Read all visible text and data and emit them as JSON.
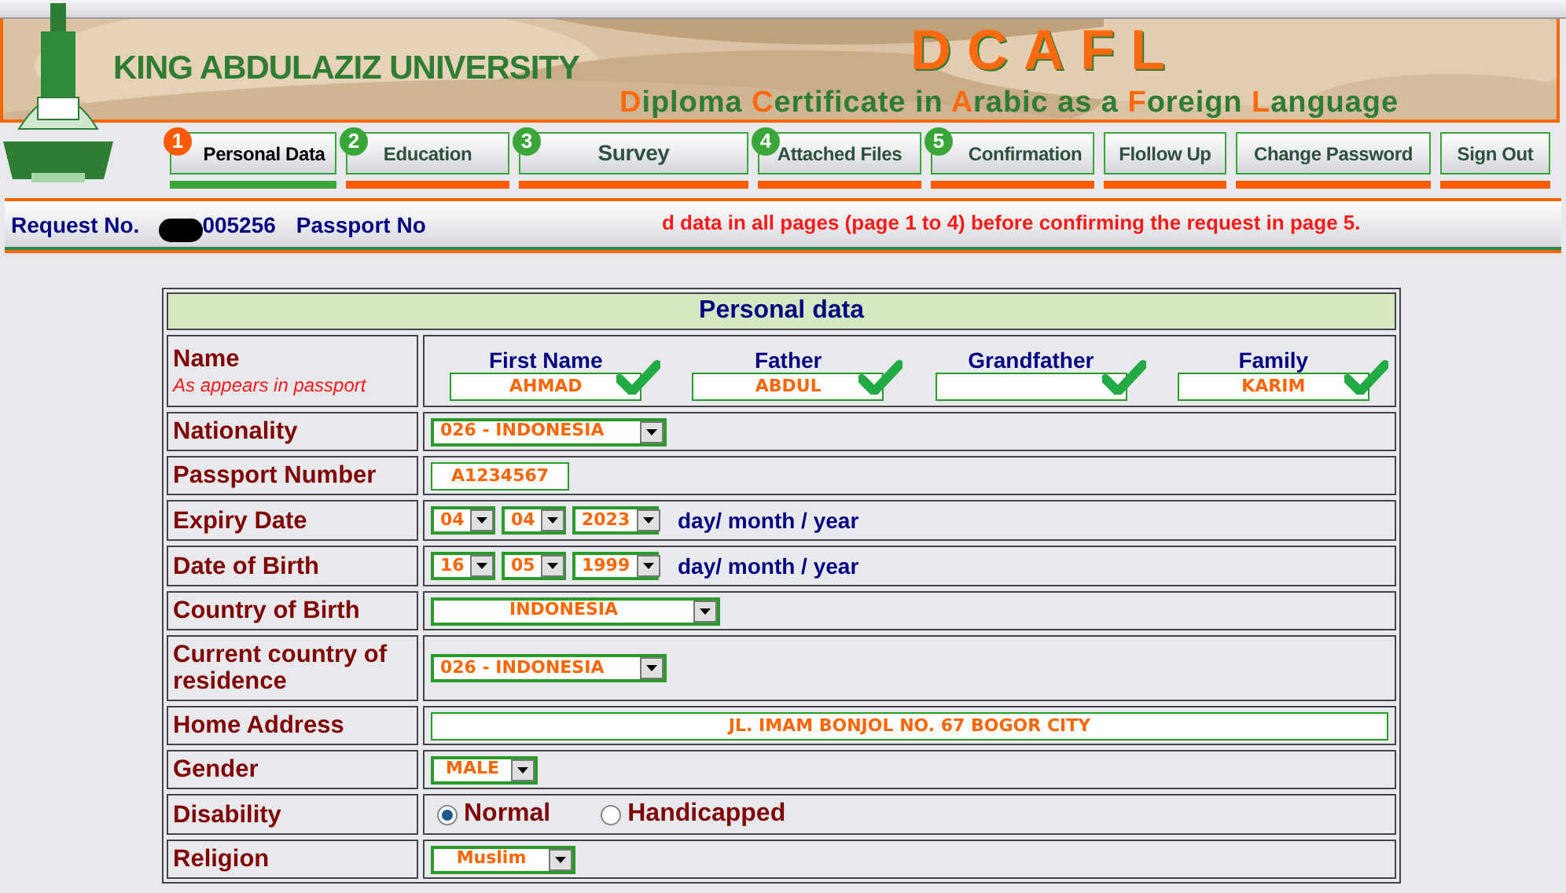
{
  "banner": {
    "university": "KING ABDULAZIZ UNIVERSITY",
    "acronym": "DCAFL",
    "subtitle_parts": [
      {
        "text": "D",
        "accent": true
      },
      {
        "text": "iploma ",
        "accent": false
      },
      {
        "text": "C",
        "accent": true
      },
      {
        "text": "ertificate in ",
        "accent": false
      },
      {
        "text": "A",
        "accent": true
      },
      {
        "text": "rabic as a ",
        "accent": false
      },
      {
        "text": "F",
        "accent": true
      },
      {
        "text": "oreign ",
        "accent": false
      },
      {
        "text": "L",
        "accent": true
      },
      {
        "text": "anguage",
        "accent": false
      }
    ]
  },
  "nav": [
    {
      "number": "1",
      "label": "Personal Data",
      "selected": true
    },
    {
      "number": "2",
      "label": "Education",
      "selected": false
    },
    {
      "number": "3",
      "label": "Survey",
      "selected": false
    },
    {
      "number": "4",
      "label": "Attached Files",
      "selected": false
    },
    {
      "number": "5",
      "label": "Confirmation",
      "selected": false
    },
    {
      "label": "Flollow Up",
      "selected": false
    },
    {
      "label": "Change Password",
      "selected": false
    },
    {
      "label": "Sign Out",
      "selected": false
    }
  ],
  "request_bar": {
    "request_label": "Request No.",
    "request_number": "005256",
    "passport_label": "Passport No",
    "notice": "d data in all pages (page 1 to 4) before confirming the request in page 5."
  },
  "form": {
    "title": "Personal data",
    "rows": [
      {
        "kind": "name",
        "label": "Name",
        "sublabel": "As appears in passport",
        "parts": [
          {
            "label": "First Name",
            "value": "AHMAD",
            "checked": true
          },
          {
            "label": "Father",
            "value": "ABDUL",
            "checked": true
          },
          {
            "label": "Grandfather",
            "checked": true
          },
          {
            "label": "Family",
            "value": "KARIM",
            "checked": true
          }
        ]
      },
      {
        "kind": "select",
        "label": "Nationality",
        "value": "026 - INDONESIA"
      },
      {
        "kind": "text",
        "label": "Passport Number",
        "value": "A1234567"
      },
      {
        "kind": "date",
        "label": "Expiry Date",
        "fields": [
          "04",
          "04",
          "2023"
        ],
        "hint": "day/ month / year"
      },
      {
        "kind": "date",
        "label": "Date of Birth",
        "fields": [
          "16",
          "05",
          "1999"
        ],
        "hint": "day/ month / year"
      },
      {
        "kind": "wide_select",
        "label": "Country of Birth",
        "value": "INDONESIA"
      },
      {
        "kind": "select",
        "label": "Current country of residence",
        "value": "026 - INDONESIA"
      },
      {
        "kind": "address",
        "label": "Home Address",
        "value": "JL. IMAM BONJOL NO. 67 BOGOR CITY"
      },
      {
        "kind": "short_select",
        "label": "Gender",
        "value": "MALE"
      },
      {
        "kind": "radio",
        "label": "Disability",
        "options": [
          {
            "label": "Normal",
            "selected": true
          },
          {
            "label": "Handicapped",
            "selected": false
          }
        ]
      },
      {
        "kind": "short_select",
        "label": "Religion",
        "value": "Muslim"
      }
    ]
  }
}
